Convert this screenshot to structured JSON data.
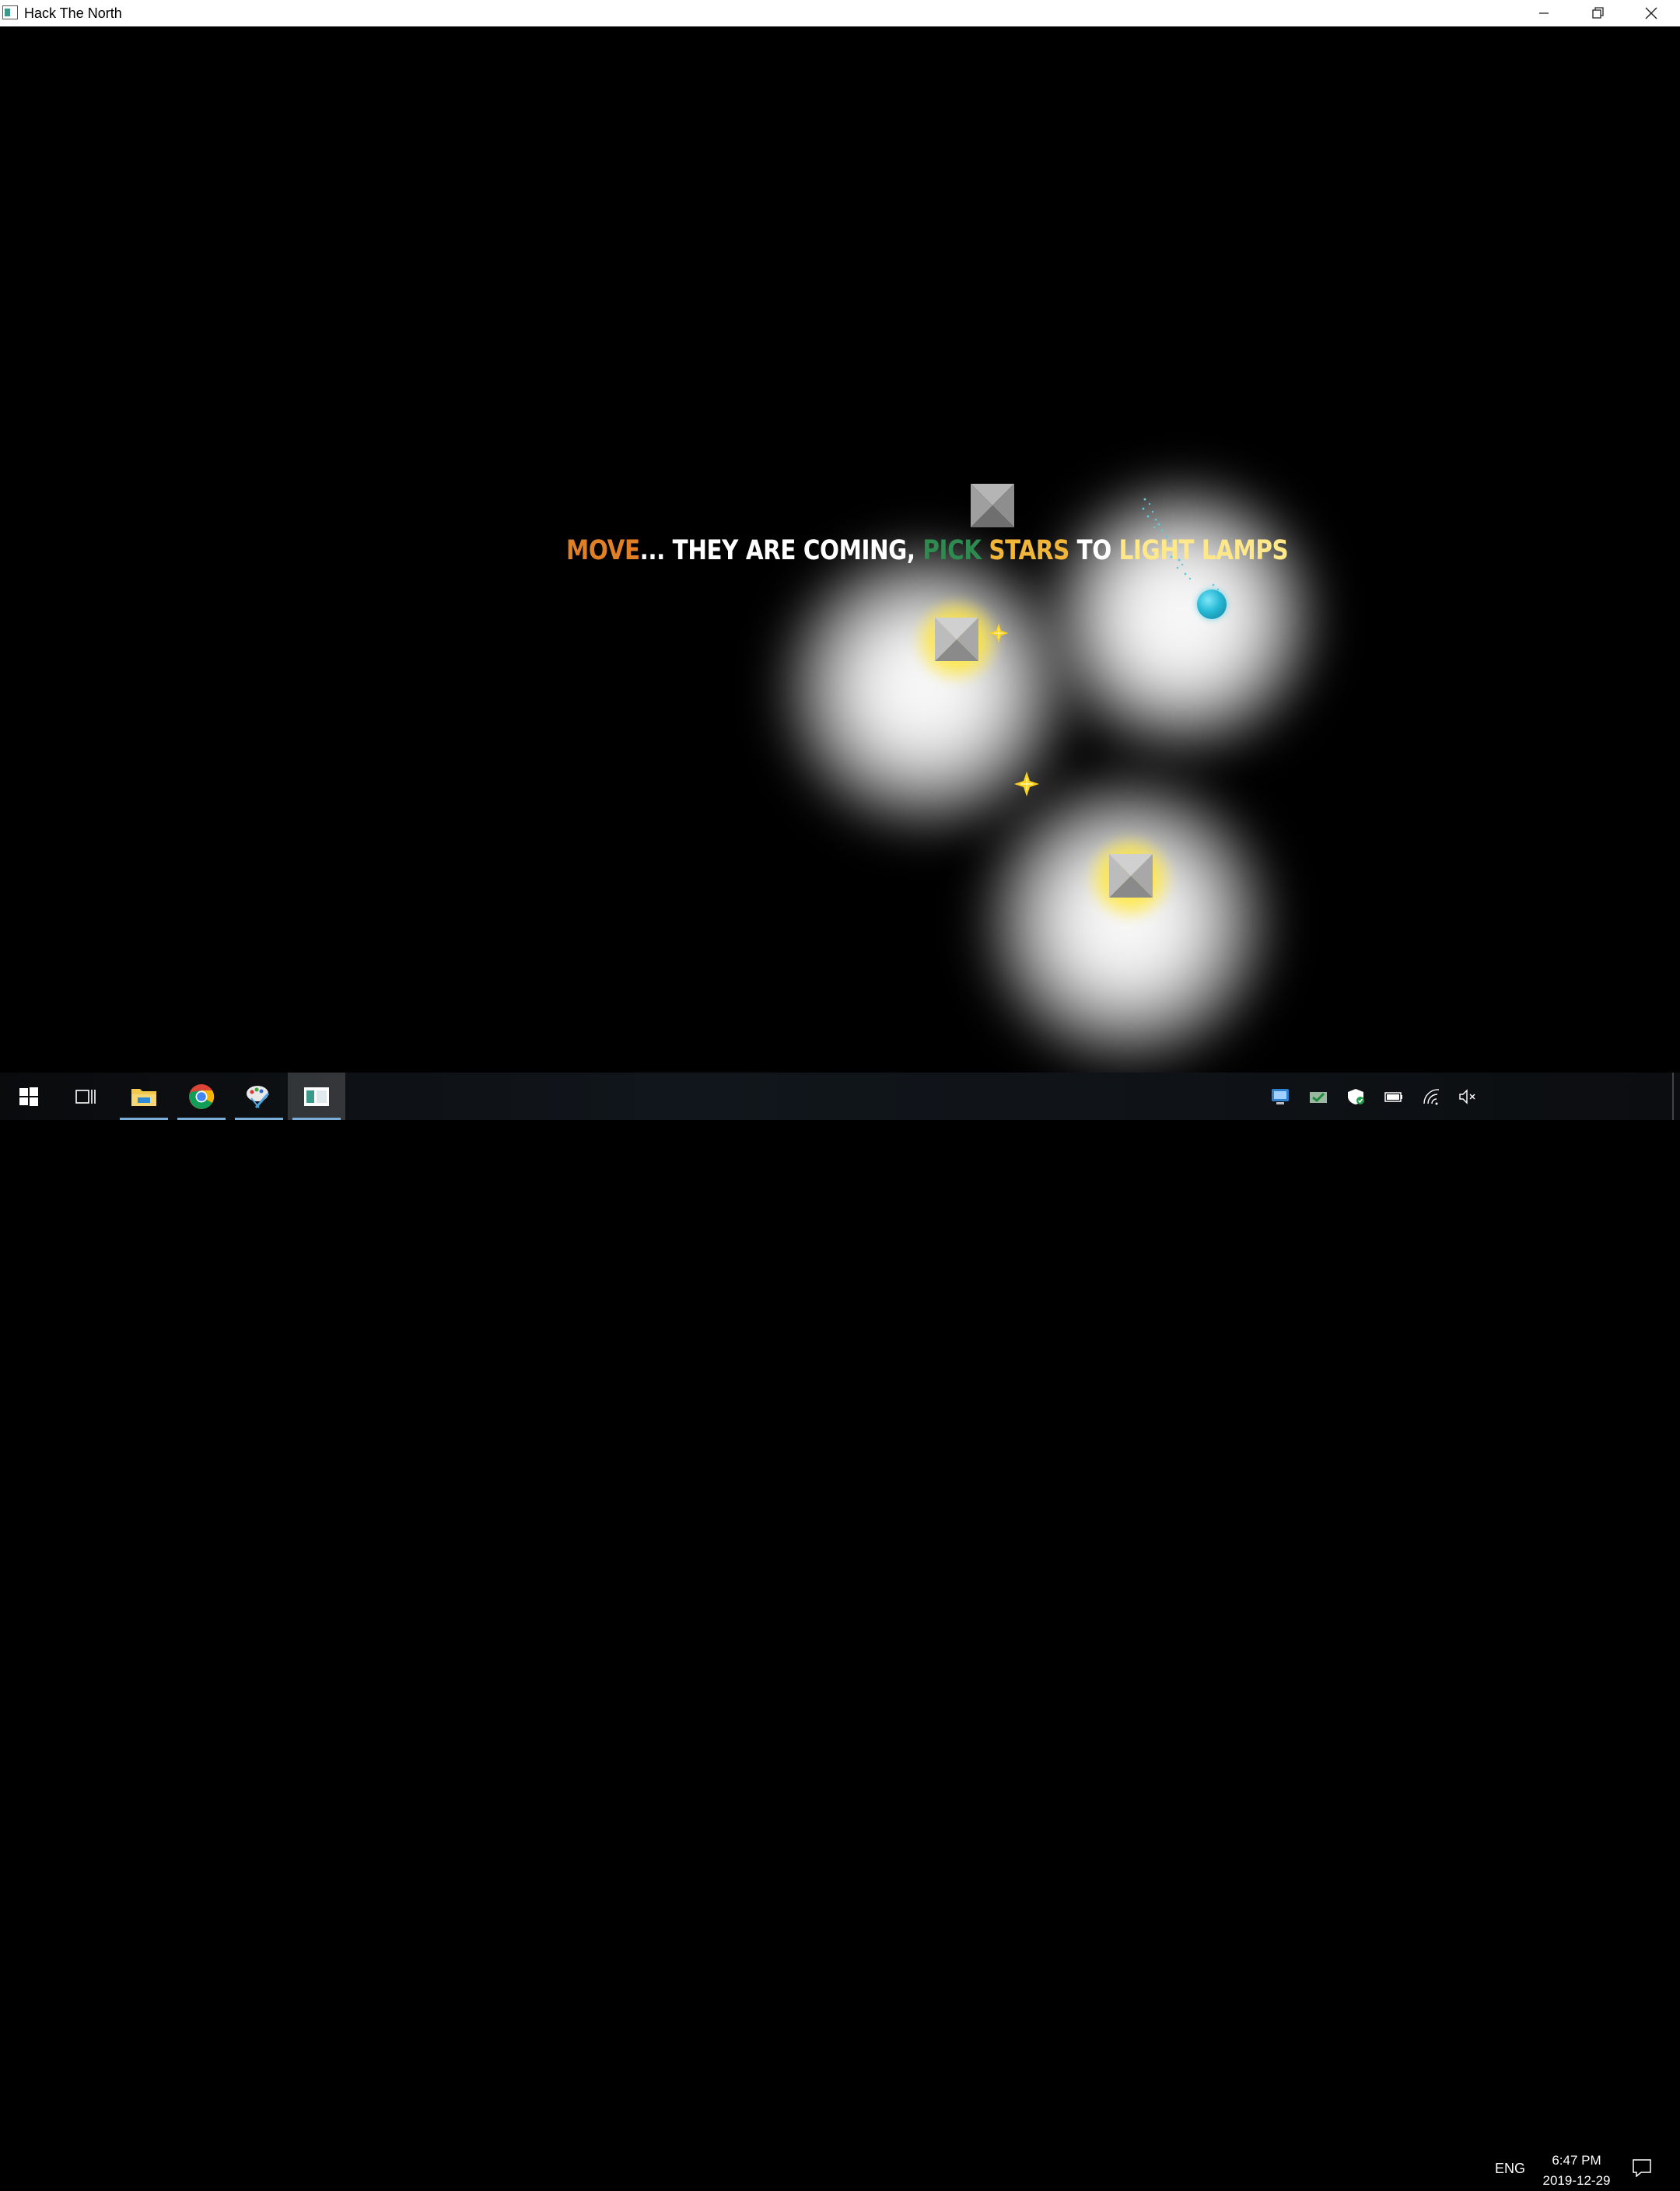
{
  "window": {
    "title": "Hack The North",
    "controls": [
      "minimize",
      "restore",
      "close"
    ]
  },
  "game": {
    "message": {
      "move": "MOVE",
      "ellipsis": "... THEY ARE COMING, ",
      "pick": "PICK ",
      "stars": "STARS",
      "to": " TO ",
      "light_lamps": "LIGHT LAMPS"
    },
    "colors": {
      "move": "#e07f25",
      "pick": "#2e8b4f",
      "stars": "#f1b53a",
      "light_lamps": "#ffe88a",
      "player": "#27b9d6",
      "star": "#ffd21a"
    },
    "lamps": 4,
    "lit_lamps": 3,
    "stars_visible": 2
  },
  "taskbar": {
    "apps": [
      {
        "name": "start",
        "icon": "windows-icon"
      },
      {
        "name": "task-view",
        "icon": "task-view-icon"
      },
      {
        "name": "file-explorer",
        "icon": "folder-icon"
      },
      {
        "name": "chrome",
        "icon": "chrome-icon"
      },
      {
        "name": "paint",
        "icon": "paint-icon"
      },
      {
        "name": "hack-the-north",
        "icon": "app-window-icon"
      }
    ],
    "tray": {
      "language": "ENG",
      "time": "6:47 PM",
      "date": "2019-12-29"
    }
  }
}
